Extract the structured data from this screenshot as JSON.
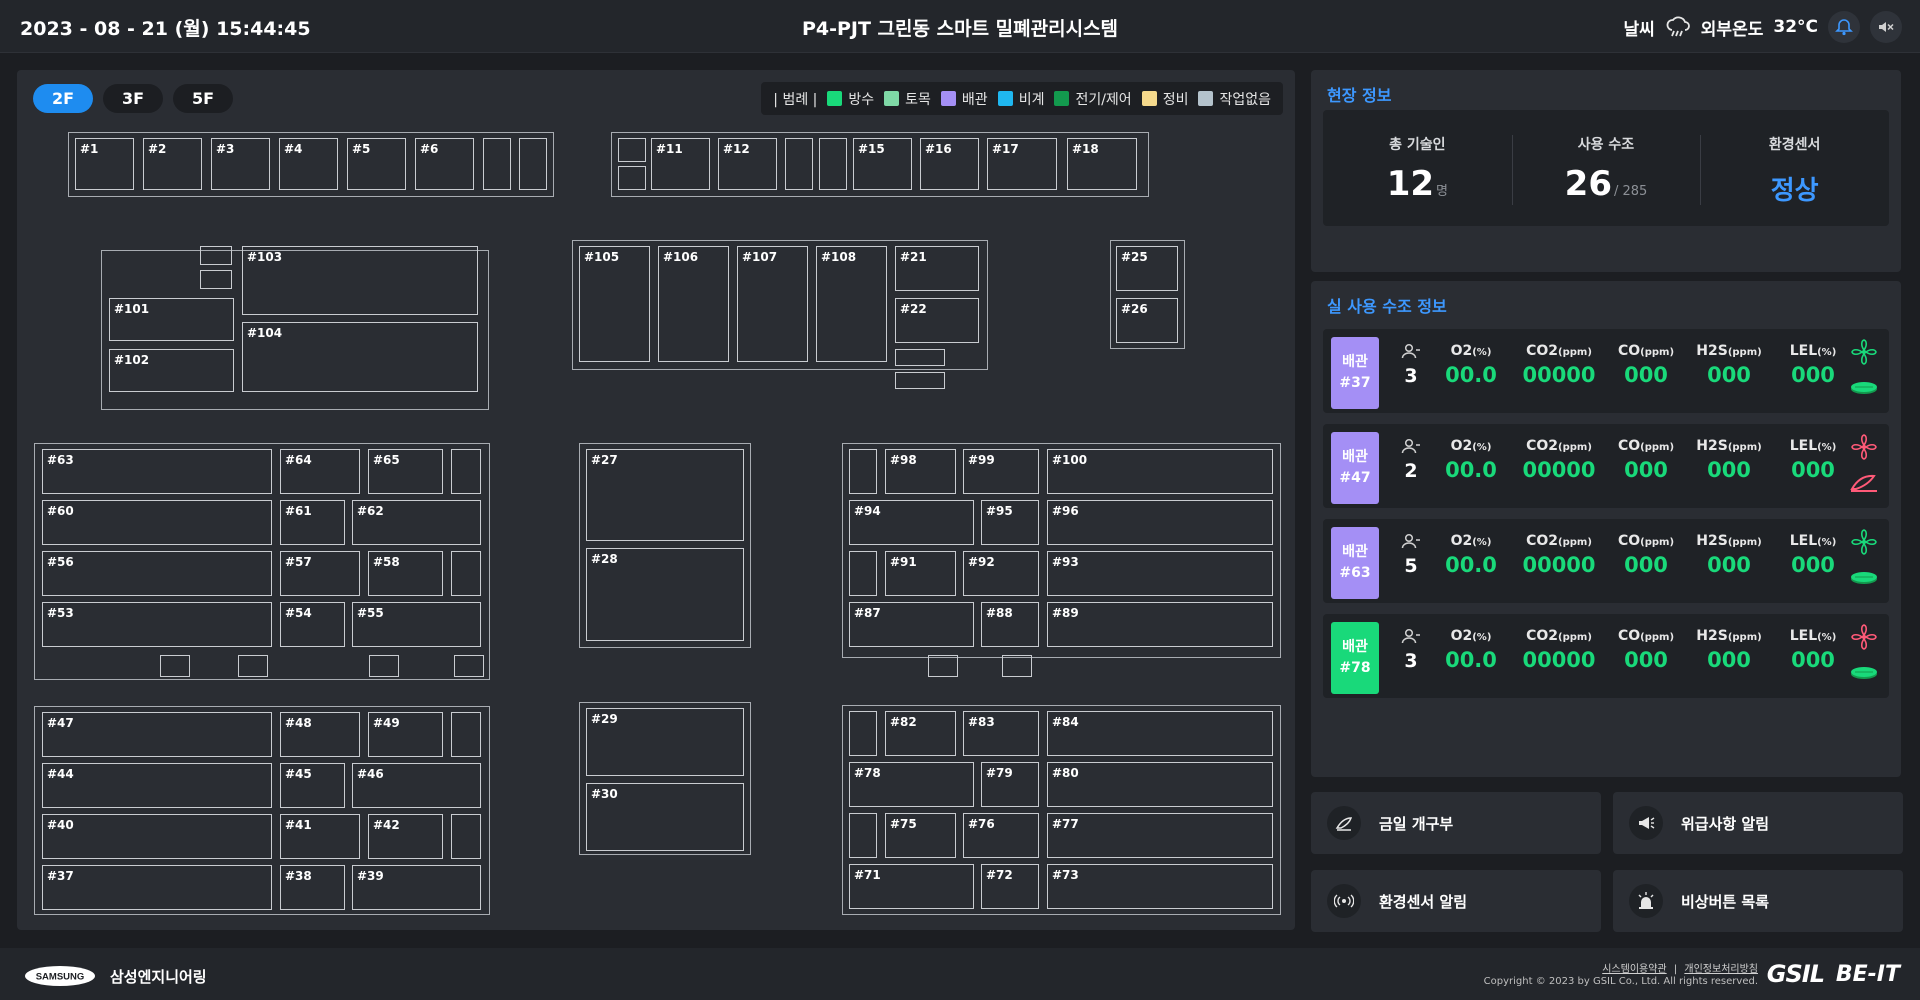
{
  "header": {
    "datetime": "2023 - 08 - 21 (월)  15:44:45",
    "title": "P4-PJT 그린동 스마트 밀폐관리시스템",
    "weather_label": "날씨",
    "outside_temp_label": "외부온도",
    "outside_temp_value": "32°C",
    "weather_icon": "rain-cloud-icon",
    "notification_icon": "bell-icon",
    "sound_icon": "mute-icon"
  },
  "floors": {
    "tabs": [
      "2F",
      "3F",
      "5F"
    ],
    "active": "2F"
  },
  "legend": {
    "title": "| 범례 |",
    "items": [
      {
        "label": "방수",
        "color": "#19d97a"
      },
      {
        "label": "토목",
        "color": "#7fd8a6"
      },
      {
        "label": "배관",
        "color": "#a48ff5"
      },
      {
        "label": "비계",
        "color": "#1fb7f0"
      },
      {
        "label": "전기/제어",
        "color": "#139a4e"
      },
      {
        "label": "정비",
        "color": "#f5d98c"
      },
      {
        "label": "작업없음",
        "color": "#b4c2cc"
      }
    ]
  },
  "rooms": {
    "r1": "#1",
    "r2": "#2",
    "r3": "#3",
    "r4": "#4",
    "r5": "#5",
    "r6": "#6",
    "r11": "#11",
    "r12": "#12",
    "r15": "#15",
    "r16": "#16",
    "r17": "#17",
    "r18": "#18",
    "r101": "#101",
    "r102": "#102",
    "r103": "#103",
    "r104": "#104",
    "r105": "#105",
    "r106": "#106",
    "r107": "#107",
    "r108": "#108",
    "r21": "#21",
    "r22": "#22",
    "r25": "#25",
    "r26": "#26",
    "r63": "#63",
    "r64": "#64",
    "r65": "#65",
    "r60": "#60",
    "r61": "#61",
    "r62": "#62",
    "r56": "#56",
    "r57": "#57",
    "r58": "#58",
    "r53": "#53",
    "r54": "#54",
    "r55": "#55",
    "r27": "#27",
    "r28": "#28",
    "r29": "#29",
    "r30": "#30",
    "r98": "#98",
    "r99": "#99",
    "r100": "#100",
    "r94": "#94",
    "r95": "#95",
    "r96": "#96",
    "r91": "#91",
    "r92": "#92",
    "r93": "#93",
    "r87": "#87",
    "r88": "#88",
    "r89": "#89",
    "r47": "#47",
    "r48": "#48",
    "r49": "#49",
    "r44": "#44",
    "r45": "#45",
    "r46": "#46",
    "r40": "#40",
    "r41": "#41",
    "r42": "#42",
    "r37": "#37",
    "r38": "#38",
    "r39": "#39",
    "r82": "#82",
    "r83": "#83",
    "r84": "#84",
    "r78": "#78",
    "r79": "#79",
    "r80": "#80",
    "r75": "#75",
    "r76": "#76",
    "r77": "#77",
    "r71": "#71",
    "r72": "#72",
    "r73": "#73"
  },
  "site_info": {
    "title": "현장 정보",
    "workers_label": "총 기술인",
    "workers_value": "12",
    "workers_unit": "명",
    "tanks_label": "사용 수조",
    "tanks_value": "26",
    "tanks_total": "/ 285",
    "env_label": "환경센서",
    "env_value": "정상"
  },
  "tank_info": {
    "title": "실 사용 수조 정보",
    "sensor_labels": {
      "o2": "O2",
      "o2_unit": "(%)",
      "co2": "CO2",
      "co2_unit": "(ppm)",
      "co": "CO",
      "co_unit": "(ppm)",
      "h2s": "H2S",
      "h2s_unit": "(ppm)",
      "lel": "LEL",
      "lel_unit": "(%)"
    },
    "tanks": [
      {
        "type": "배관",
        "id": "#37",
        "color": "#a48ff5",
        "people": "3",
        "o2": "00.0",
        "co2": "00000",
        "co": "000",
        "h2s": "000",
        "lel": "000",
        "fan_icon": "fan-on-icon",
        "status_icon": "manhole-icon"
      },
      {
        "type": "배관",
        "id": "#47",
        "color": "#a48ff5",
        "people": "2",
        "o2": "00.0",
        "co2": "00000",
        "co": "000",
        "h2s": "000",
        "lel": "000",
        "fan_icon": "fan-off-icon",
        "status_icon": "manhole-open-icon"
      },
      {
        "type": "배관",
        "id": "#63",
        "color": "#a48ff5",
        "people": "5",
        "o2": "00.0",
        "co2": "00000",
        "co": "000",
        "h2s": "000",
        "lel": "000",
        "fan_icon": "fan-on-icon",
        "status_icon": "manhole-icon"
      },
      {
        "type": "배관",
        "id": "#78",
        "color": "#19d97a",
        "people": "3",
        "o2": "00.0",
        "co2": "00000",
        "co": "000",
        "h2s": "000",
        "lel": "000",
        "fan_icon": "fan-off-icon",
        "status_icon": "manhole-icon"
      }
    ]
  },
  "menu": {
    "open_today": "금일 개구부",
    "danger_alert": "위급사항 알림",
    "env_alert": "환경센서 알림",
    "emergency_list": "비상버튼 목록"
  },
  "footer": {
    "company": "삼성엔지니어링",
    "logo_text": "SAMSUNG",
    "terms": "시스템이용약관",
    "separator": "|",
    "privacy": "개인정보처리방침",
    "copyright": "Copyright © 2023 by GSIL Co., Ltd. All rights reserved.",
    "gsil": "GSIL",
    "beit": "BE-IT"
  }
}
